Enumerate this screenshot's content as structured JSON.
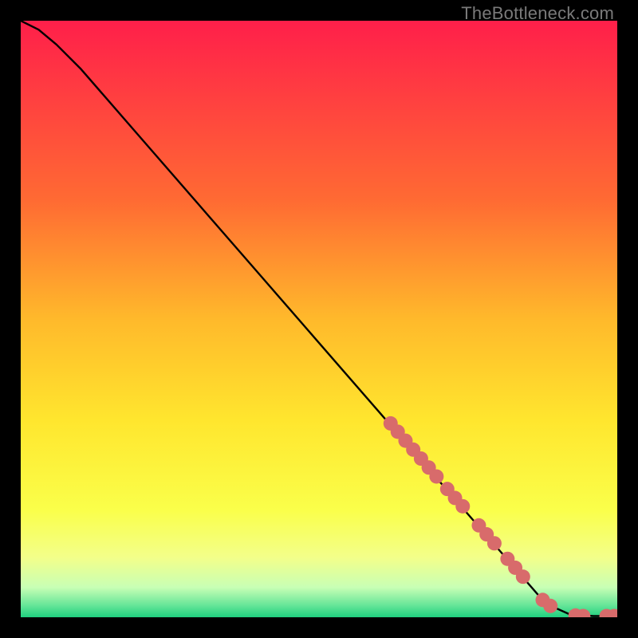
{
  "attribution": "TheBottleneck.com",
  "chart_data": {
    "type": "line",
    "title": "",
    "xlabel": "",
    "ylabel": "",
    "xlim": [
      0,
      100
    ],
    "ylim": [
      0,
      100
    ],
    "background_gradient_stops": [
      {
        "y": 100,
        "color": "#ff1f4a"
      },
      {
        "y": 70,
        "color": "#ff6a33"
      },
      {
        "y": 50,
        "color": "#ffb92b"
      },
      {
        "y": 33,
        "color": "#ffe62e"
      },
      {
        "y": 18,
        "color": "#faff4a"
      },
      {
        "y": 10,
        "color": "#f3ff8a"
      },
      {
        "y": 5,
        "color": "#c8ffb5"
      },
      {
        "y": 2,
        "color": "#66e598"
      },
      {
        "y": 0,
        "color": "#1fd07f"
      }
    ],
    "curve": {
      "x": [
        0,
        3,
        6,
        10,
        20,
        30,
        40,
        50,
        60,
        70,
        80,
        88,
        92,
        96,
        100
      ],
      "y": [
        100,
        98.5,
        96,
        92,
        80.5,
        69,
        57.5,
        46,
        34.5,
        23,
        11.5,
        2.3,
        0.5,
        0.2,
        0.2
      ]
    },
    "markers": {
      "color": "#d86b6b",
      "radius": 9,
      "points": [
        {
          "x": 62,
          "y": 32.5
        },
        {
          "x": 63.2,
          "y": 31.1
        },
        {
          "x": 64.5,
          "y": 29.6
        },
        {
          "x": 65.8,
          "y": 28.1
        },
        {
          "x": 67.1,
          "y": 26.6
        },
        {
          "x": 68.4,
          "y": 25.1
        },
        {
          "x": 69.7,
          "y": 23.6
        },
        {
          "x": 71.5,
          "y": 21.5
        },
        {
          "x": 72.8,
          "y": 20.0
        },
        {
          "x": 74.1,
          "y": 18.6
        },
        {
          "x": 76.8,
          "y": 15.4
        },
        {
          "x": 78.1,
          "y": 13.9
        },
        {
          "x": 79.4,
          "y": 12.4
        },
        {
          "x": 81.6,
          "y": 9.8
        },
        {
          "x": 82.9,
          "y": 8.3
        },
        {
          "x": 84.2,
          "y": 6.8
        },
        {
          "x": 87.5,
          "y": 2.9
        },
        {
          "x": 88.8,
          "y": 1.9
        },
        {
          "x": 93.0,
          "y": 0.3
        },
        {
          "x": 94.3,
          "y": 0.2
        },
        {
          "x": 98.2,
          "y": 0.2
        },
        {
          "x": 99.5,
          "y": 0.2
        }
      ]
    }
  }
}
